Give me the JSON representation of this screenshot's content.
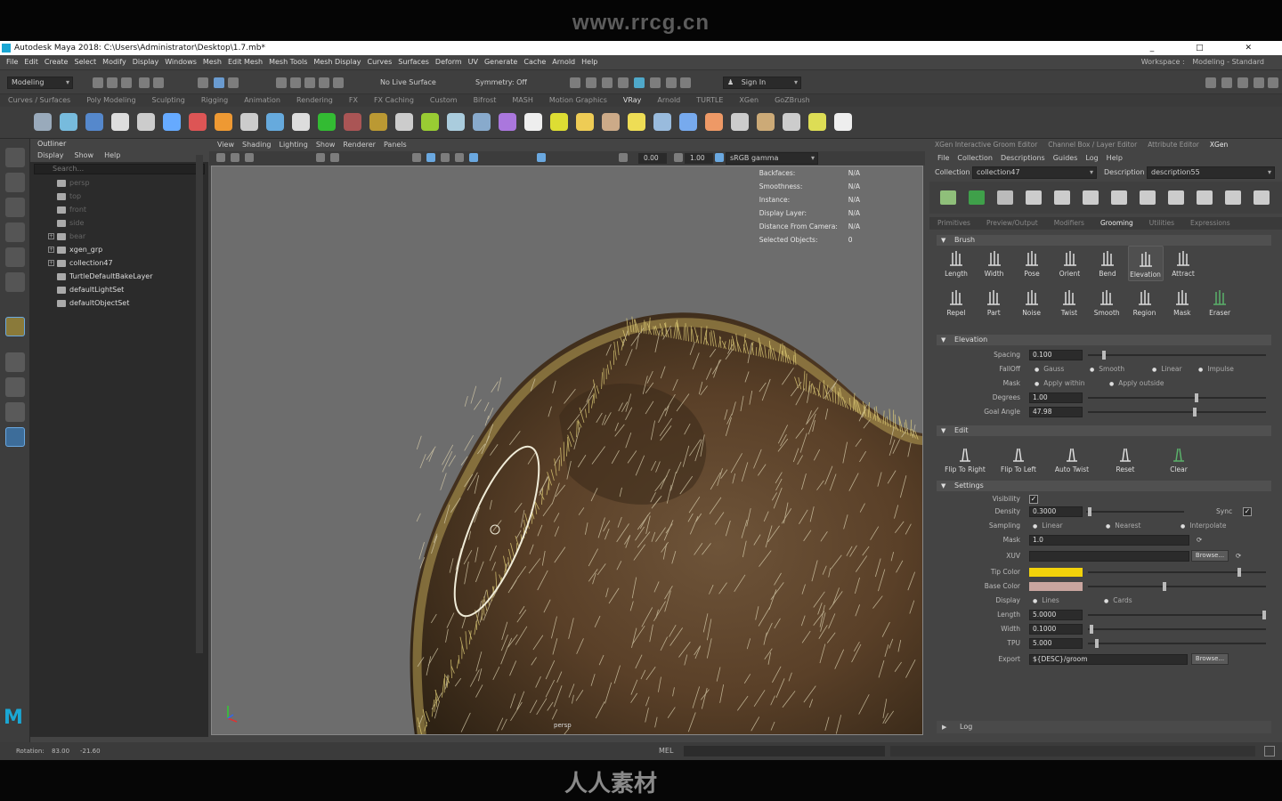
{
  "banner_text": "www.rrcg.cn",
  "bottom_banner": {
    "logo_text": "人人素材"
  },
  "window": {
    "title": "Autodesk Maya 2018: C:\\Users\\Administrator\\Desktop\\1.7.mb*",
    "controls": "_ □ ✕"
  },
  "menubar": {
    "items": [
      "File",
      "Edit",
      "Create",
      "Select",
      "Modify",
      "Display",
      "Windows",
      "Mesh",
      "Edit Mesh",
      "Mesh Tools",
      "Mesh Display",
      "Curves",
      "Surfaces",
      "Deform",
      "UV",
      "Generate",
      "Cache",
      "Arnold",
      "Help"
    ],
    "workspace_label": "Workspace :",
    "workspace_value": "Modeling - Standard"
  },
  "statusline": {
    "mode": "Modeling",
    "live_surface": "No Live Surface",
    "symmetry": "Symmetry: Off",
    "sign_in": "Sign In"
  },
  "shelf": {
    "tabs": [
      "Curves / Surfaces",
      "Poly Modeling",
      "Sculpting",
      "Rigging",
      "Animation",
      "Rendering",
      "FX",
      "FX Caching",
      "Custom",
      "Bifrost",
      "MASH",
      "Motion Graphics",
      "VRay",
      "Arnold",
      "TURTLE",
      "XGen",
      "GoZBrush"
    ],
    "active_tab": "VRay",
    "icon_colors": [
      "#9ab",
      "#7bd",
      "#58c",
      "#ddd",
      "#ccc",
      "#6af",
      "#d55",
      "#e93",
      "#ccc",
      "#6ad",
      "#ddd",
      "#3b3",
      "#a55",
      "#b93",
      "#ccc",
      "#9c3",
      "#acd",
      "#8ac",
      "#a7d",
      "#eee",
      "#dd3",
      "#ec5",
      "#ca8",
      "#ed5",
      "#9bd",
      "#7ae",
      "#e96",
      "#ccc",
      "#ca7",
      "#ccc",
      "#dd5",
      "#eee"
    ]
  },
  "outliner": {
    "title": "Outliner",
    "menu": [
      "Display",
      "Show",
      "Help"
    ],
    "search_placeholder": "Search...",
    "rows": [
      {
        "label": "persp",
        "dim": true,
        "icon": "camera-icon"
      },
      {
        "label": "top",
        "dim": true,
        "icon": "camera-icon"
      },
      {
        "label": "front",
        "dim": true,
        "icon": "camera-icon"
      },
      {
        "label": "side",
        "dim": true,
        "icon": "camera-icon"
      },
      {
        "label": "bear",
        "dim": true,
        "icon": "mesh-icon",
        "expand": "+"
      },
      {
        "label": "xgen_grp",
        "dim": false,
        "icon": "mesh-icon",
        "expand": "+"
      },
      {
        "label": "collection47",
        "dim": false,
        "icon": "xgen-collection-icon",
        "expand": "+"
      },
      {
        "label": "TurtleDefaultBakeLayer",
        "dim": false,
        "icon": "bake-layer-icon"
      },
      {
        "label": "defaultLightSet",
        "dim": false,
        "icon": "set-icon"
      },
      {
        "label": "defaultObjectSet",
        "dim": false,
        "icon": "set-icon"
      }
    ]
  },
  "viewport": {
    "menu": [
      "View",
      "Shading",
      "Lighting",
      "Show",
      "Renderer",
      "Panels"
    ],
    "field1": "0.00",
    "field2": "1.00",
    "color_space": "sRGB gamma",
    "hud": [
      {
        "k": "Backfaces:",
        "v": "N/A"
      },
      {
        "k": "Smoothness:",
        "v": "N/A"
      },
      {
        "k": "Instance:",
        "v": "N/A"
      },
      {
        "k": "Display Layer:",
        "v": "N/A"
      },
      {
        "k": "Distance From Camera:",
        "v": "N/A"
      },
      {
        "k": "Selected Objects:",
        "v": "0"
      }
    ],
    "camera_label": "persp"
  },
  "xgen": {
    "panel_tabs": [
      "XGen Interactive Groom Editor",
      "Channel Box / Layer Editor",
      "Attribute Editor",
      "XGen"
    ],
    "active_panel_tab": "XGen",
    "menu": [
      "File",
      "Collection",
      "Descriptions",
      "Guides",
      "Log",
      "Help"
    ],
    "collection_label": "Collection",
    "collection_value": "collection47",
    "description_label": "Description",
    "description_value": "description55",
    "subtabs": [
      "Primitives",
      "Preview/Output",
      "Modifiers",
      "Grooming",
      "Utilities",
      "Expressions"
    ],
    "active_subtab": "Grooming",
    "brush_section": "Brush",
    "brushes": [
      "Length",
      "Width",
      "Pose",
      "Orient",
      "Bend",
      "Elevation",
      "Attract",
      "Repel",
      "Part",
      "Noise",
      "Twist",
      "Smooth",
      "Region",
      "Mask",
      "Eraser"
    ],
    "active_brush": "Elevation",
    "elevation_section": "Elevation",
    "elevation": {
      "spacing_label": "Spacing",
      "spacing": "0.100",
      "spacing_pos": 0.09,
      "falloff_label": "FallOff",
      "falloff_options": [
        "Gauss",
        "Smooth",
        "Linear",
        "Impulse"
      ],
      "mask_label": "Mask",
      "mask_options": [
        "Apply within",
        "Apply outside"
      ],
      "degrees_label": "Degrees",
      "degrees": "1.00",
      "degrees_pos": 0.61,
      "goal_label": "Goal Angle",
      "goal": "47.98",
      "goal_pos": 0.6
    },
    "edit_section": "Edit",
    "edit_buttons": [
      "Flip To Right",
      "Flip To Left",
      "Auto Twist",
      "Reset",
      "Clear"
    ],
    "settings_section": "Settings",
    "settings": {
      "visibility_label": "Visibility",
      "density_label": "Density",
      "density": "0.3000",
      "density_pos": 0.04,
      "sync_label": "Sync",
      "sampling_label": "Sampling",
      "sampling_options": [
        "Linear",
        "Nearest",
        "Interpolate"
      ],
      "mask_label": "Mask",
      "mask": "1.0",
      "xuv_label": "XUV",
      "browse_label": "Browse...",
      "tip_color_label": "Tip Color",
      "tip_color": "#f2d20a",
      "base_color_label": "Base Color",
      "base_color": "#c9a59f",
      "display_label": "Display",
      "display_options": [
        "Lines",
        "Cards"
      ],
      "length_label": "Length",
      "length": "5.0000",
      "length_pos": 1.0,
      "width_label": "Width",
      "width": "0.1000",
      "width_pos": 0.02,
      "tpu_label": "TPU",
      "tpu": "5.000",
      "tpu_pos": 0.05,
      "export_label": "Export",
      "export": "${DESC}/groom"
    },
    "log_label": "Log"
  },
  "statusbar": {
    "rotation_label": "Rotation:",
    "rotation_x": "83.00",
    "rotation_y": "-21.60",
    "mel": "MEL"
  }
}
